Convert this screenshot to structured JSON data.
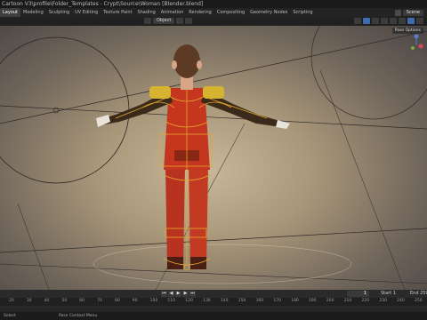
{
  "window": {
    "title": "Cartoon V3\\profile\\Folder_Templates - Crypt\\Source\\Woman [Blender.blend]"
  },
  "workspaces": {
    "tabs": [
      "Layout",
      "Modeling",
      "Sculpting",
      "UV Editing",
      "Texture Paint",
      "Shading",
      "Animation",
      "Rendering",
      "Compositing",
      "Geometry Nodes",
      "Scripting"
    ],
    "active": "Layout",
    "scene_label": "Scene"
  },
  "viewport": {
    "mode": "Object",
    "pose_options": "Pose Options",
    "accent": "#e3a82d"
  },
  "timeline": {
    "current_frame": "1",
    "start_label": "Start",
    "start_value": "1",
    "end_label": "End",
    "end_value": "250",
    "ruler_ticks": [
      "20",
      "30",
      "40",
      "50",
      "60",
      "70",
      "80",
      "90",
      "100",
      "110",
      "120",
      "130",
      "140",
      "150",
      "160",
      "170",
      "180",
      "190",
      "200",
      "210",
      "220",
      "230",
      "240",
      "250"
    ]
  },
  "status": {
    "left": "Select",
    "right": "Pose Context Menu"
  }
}
